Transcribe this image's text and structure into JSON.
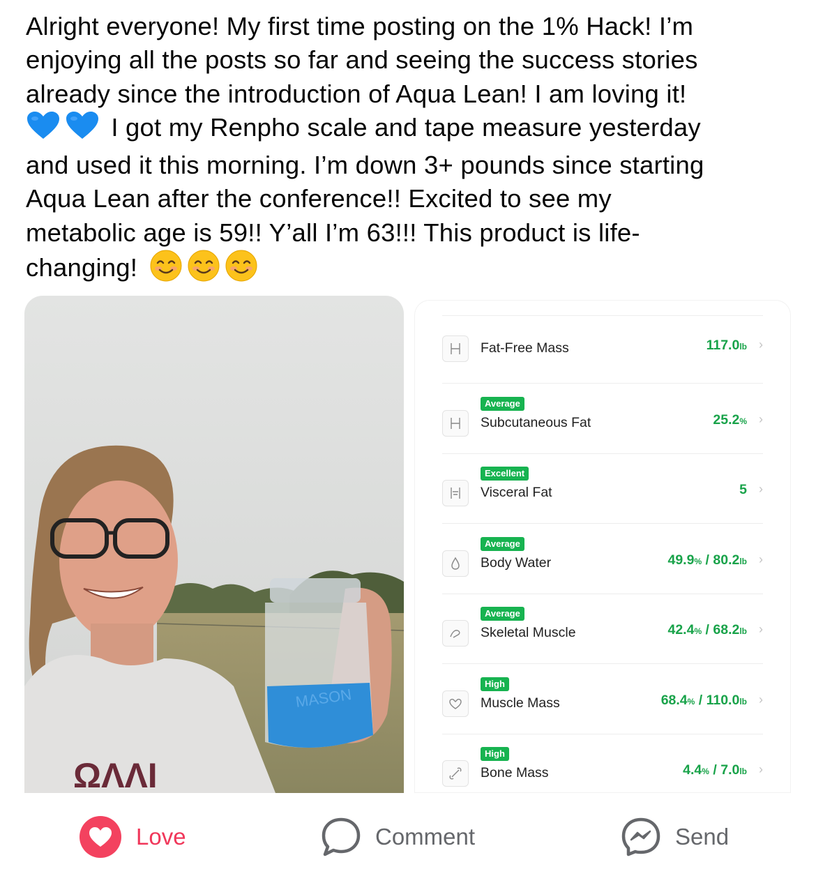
{
  "post": {
    "lines": [
      "Alright everyone! My first time posting on the 1% Hack! I’m",
      "enjoying all the posts so far and seeing the success stories",
      "already since the introduction of Aqua Lean! I am loving it!",
      " I got my Renpho scale and tape measure yesterday",
      "and used it this morning. I’m down 3+ pounds since starting",
      "Aqua Lean after the conference!! Excited to see my",
      "metabolic age is 59!! Y’all I’m 63!!! This product is life-",
      "changing!"
    ],
    "heart_emoji": "blue-heart-icon",
    "smile_emoji": "smiling-face-icon",
    "jar_text": "MASON"
  },
  "metrics": [
    {
      "icon": "body-outline-icon",
      "badge": "",
      "label": "Fat-Free Mass",
      "value": "117.0",
      "unit": "lb",
      "value2": "",
      "unit2": ""
    },
    {
      "icon": "body-outline-icon",
      "badge": "Average",
      "label": "Subcutaneous Fat",
      "value": "25.2",
      "unit": "%",
      "value2": "",
      "unit2": ""
    },
    {
      "icon": "torso-icon",
      "badge": "Excellent",
      "label": "Visceral Fat",
      "value": "5",
      "unit": "",
      "value2": "",
      "unit2": ""
    },
    {
      "icon": "water-drop-icon",
      "badge": "Average",
      "label": "Body Water",
      "value": "49.9",
      "unit": "%",
      "value2": "80.2",
      "unit2": "lb"
    },
    {
      "icon": "muscle-icon",
      "badge": "Average",
      "label": "Skeletal Muscle",
      "value": "42.4",
      "unit": "%",
      "value2": "68.2",
      "unit2": "lb"
    },
    {
      "icon": "heart-muscle-icon",
      "badge": "High",
      "label": "Muscle Mass",
      "value": "68.4",
      "unit": "%",
      "value2": "110.0",
      "unit2": "lb"
    },
    {
      "icon": "bone-icon",
      "badge": "High",
      "label": "Bone Mass",
      "value": "4.4",
      "unit": "%",
      "value2": "7.0",
      "unit2": "lb"
    }
  ],
  "actions": {
    "love": "Love",
    "comment": "Comment",
    "send": "Send"
  },
  "colors": {
    "badge": "#17b350",
    "value": "#19a34a",
    "love": "#f0375a",
    "jar_liquid": "#2f8ed8"
  }
}
